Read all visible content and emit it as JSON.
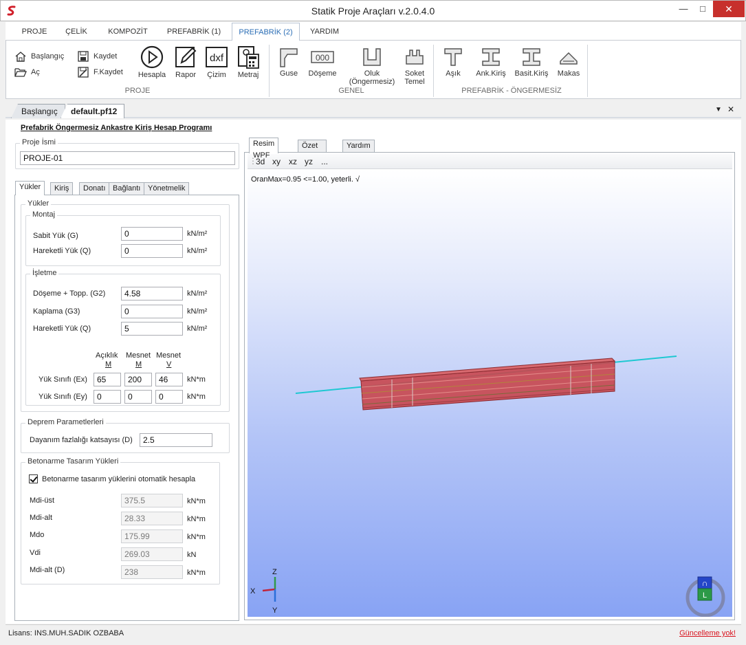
{
  "window": {
    "title": "Statik Proje Araçları v.2.0.4.0",
    "minimize": "—",
    "maximize": "□",
    "close": "✕"
  },
  "menu": {
    "tabs": [
      "PROJE",
      "ÇELİK",
      "KOMPOZİT",
      "PREFABRİK (1)",
      "PREFABRİK (2)",
      "YARDIM"
    ],
    "active": "PREFABRİK (2)"
  },
  "ribbon": {
    "proje": {
      "start": "Başlangıç",
      "open": "Aç",
      "save": "Kaydet",
      "save_as": "F.Kaydet",
      "calculate": "Hesapla",
      "report": "Rapor",
      "drawing": "Çizim",
      "dxf": "dxf",
      "quantity": "Metraj",
      "group": "PROJE"
    },
    "genel": {
      "guse": "Guse",
      "doseme": "Döşeme",
      "doseme_icon_text": "000",
      "oluk_line1": "Oluk",
      "oluk_line2": "(Öngermesiz)",
      "soket_line1": "Soket",
      "soket_line2": "Temel",
      "group": "GENEL"
    },
    "prefabrik": {
      "asik": "Aşık",
      "ank_kiris": "Ank.Kiriş",
      "basit_kiris": "Basit.Kiriş",
      "makas": "Makas",
      "group": "PREFABRİK - ÖNGERMESİZ"
    }
  },
  "doc_tabs": {
    "items": [
      "Başlangıç",
      "default.pf12"
    ],
    "active": "default.pf12",
    "dropdown": "▼",
    "close": "✕"
  },
  "form": {
    "heading": "Prefabrik Öngermesiz Ankastre Kiriş Hesap Programı",
    "project_name_label": "Proje İsmi",
    "project_name": "PROJE-01",
    "tabs": [
      "Yükler",
      "Kiriş",
      "Donatı",
      "Bağlantı",
      "Yönetmelik"
    ],
    "active_tab": "Yükler",
    "loads_group": "Yükler",
    "montaj": {
      "title": "Montaj",
      "rows": [
        {
          "label": "Sabit Yük (G)",
          "value": "0",
          "unit": "kN/m²"
        },
        {
          "label": "Hareketli Yük (Q)",
          "value": "0",
          "unit": "kN/m²"
        }
      ]
    },
    "isletme": {
      "title": "İşletme",
      "rows": [
        {
          "label": "Döşeme + Topp. (G2)",
          "value": "4.58",
          "unit": "kN/m²"
        },
        {
          "label": "Kaplama (G3)",
          "value": "0",
          "unit": "kN/m²"
        },
        {
          "label": "Hareketli Yük (Q)",
          "value": "5",
          "unit": "kN/m²"
        }
      ]
    },
    "load_class": {
      "headers": [
        {
          "top": "Açıklık",
          "bottom": "M"
        },
        {
          "top": "Mesnet",
          "bottom": "M"
        },
        {
          "top": "Mesnet",
          "bottom": "V"
        }
      ],
      "rows": [
        {
          "label": "Yük Sınıfı (Ex)",
          "values": [
            "65",
            "200",
            "46"
          ],
          "unit": "kN*m"
        },
        {
          "label": "Yük Sınıfı (Ey)",
          "values": [
            "0",
            "0",
            "0"
          ],
          "unit": "kN*m"
        }
      ]
    },
    "earthquake": {
      "title": "Deprem Parametlerleri",
      "label": "Dayanım fazlalığı katsayısı (D)",
      "value": "2.5"
    },
    "design": {
      "title": "Betonarme Tasarım Yükleri",
      "auto_checkbox": "Betonarme tasarım yüklerini otomatik hesapla",
      "auto_checked": true,
      "rows": [
        {
          "label": "Mdi-üst",
          "value": "375.5",
          "unit": "kN*m"
        },
        {
          "label": "Mdi-alt",
          "value": "28.33",
          "unit": "kN*m"
        },
        {
          "label": "Mdo",
          "value": "175.99",
          "unit": "kN*m"
        },
        {
          "label": "Vdi",
          "value": "269.03",
          "unit": "kN"
        },
        {
          "label": "Mdi-alt (D)",
          "value": "238",
          "unit": "kN*m"
        }
      ]
    }
  },
  "viewer": {
    "tabs": [
      "Resim WPF",
      "Özet Rapor",
      "Yardım"
    ],
    "active_tab": "Resim WPF",
    "toolbar": [
      "3d",
      "xy",
      "xz",
      "yz",
      "..."
    ],
    "ratio_text": "OranMax=0.95 <=1.00, yeterli. √",
    "axes": {
      "x": "X",
      "y": "Y",
      "z": "Z"
    },
    "cube": {
      "top": "∩",
      "front": "L"
    },
    "colors": {
      "beam": "#c8464d",
      "axis": "#1ec8d2",
      "x_axis": "#c0243a",
      "y_axis": "#2b6fd8",
      "z_axis": "#2f9a4a"
    }
  },
  "status": {
    "license": "Lisans: INS.MUH.SADIK OZBABA",
    "update": "Güncelleme yok!"
  }
}
